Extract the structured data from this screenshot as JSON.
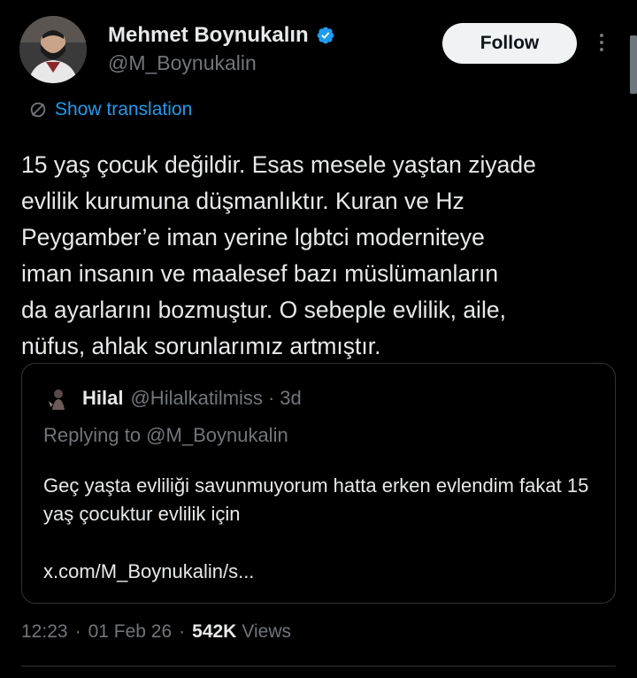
{
  "author": {
    "name": "Mehmet Boynukalın",
    "handle": "@M_Boynukalin",
    "verified_color": "#1d9bf0"
  },
  "follow_label": "Follow",
  "translate_label": "Show translation",
  "tweet_text": "15 yaş çocuk değildir. Esas mesele yaştan ziyade\nevlilik kurumuna düşmanlıktır. Kuran ve Hz\nPeygamber’e iman yerine lgbtci moderniteye\niman insanın ve maalesef bazı müslümanların\nda ayarlarını bozmuştur. O sebeple evlilik, aile,\nnüfus, ahlak sorunlarımız artmıştır.",
  "quote": {
    "name": "Hilal",
    "handle": "@Hilalkatilmiss",
    "dot": "·",
    "time": "3d",
    "replying": "Replying to @M_Boynukalin",
    "text": "Geç yaşta evliliği savunmuyorum hatta erken evlendim fakat 15 yaş çocuktur evlilik için",
    "link": "x.com/M_Boynukalin/s..."
  },
  "meta": {
    "time": "12:23",
    "sep": "·",
    "date": "01 Feb 26",
    "views_count": "542K",
    "views_label": "Views"
  },
  "colors": {
    "accent": "#1d9bf0",
    "background": "#000000",
    "muted": "#71767b"
  }
}
